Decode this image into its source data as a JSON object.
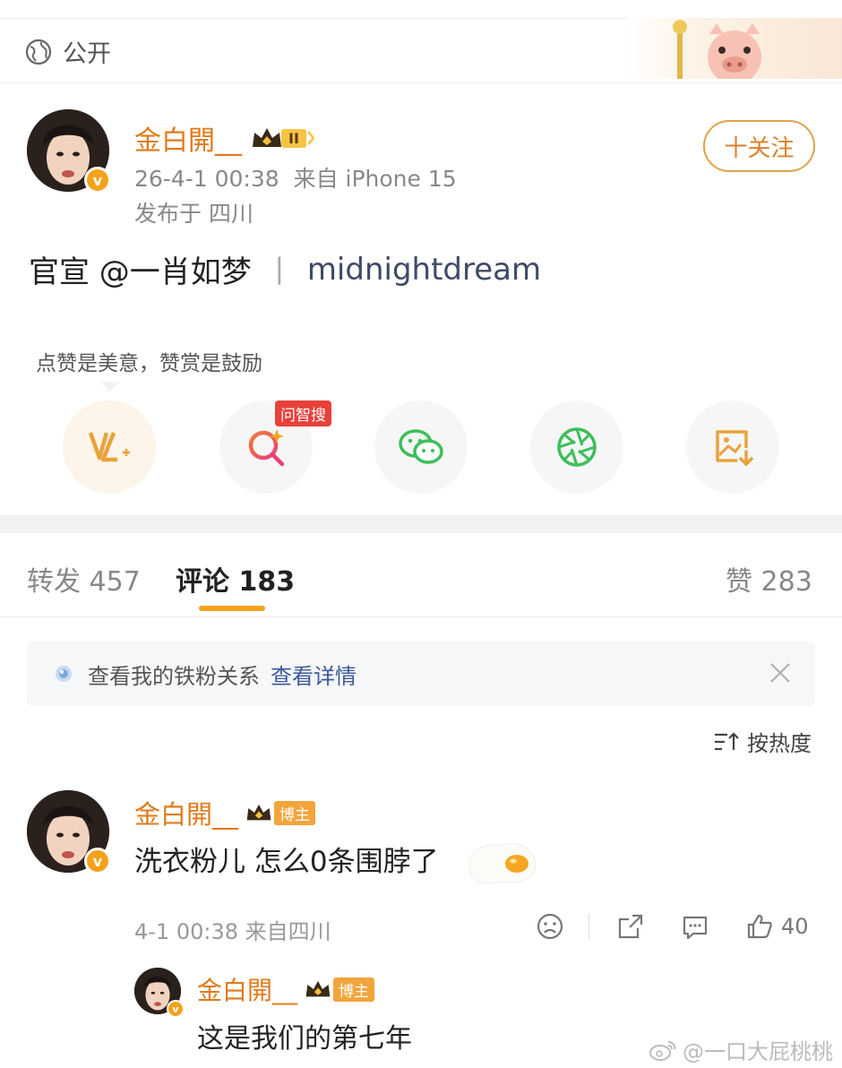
{
  "visibility": {
    "label": "公开"
  },
  "post": {
    "author": "金白開__",
    "level_badge": "II",
    "time": "26-4-1 00:38",
    "source": "来自 iPhone 15",
    "location": "发布于 四川",
    "follow_label": "十关注",
    "mention": "官宣 @一肖如梦",
    "separator": "丨",
    "link_text": "midnightdream"
  },
  "share": {
    "tip": "点赞是美意，赞赏是鼓励",
    "ai_badge": "问智搜",
    "buttons": [
      "support-icon",
      "ai-search-icon",
      "wechat-icon",
      "moments-icon",
      "save-image-icon"
    ]
  },
  "tabs": {
    "repost_label": "转发",
    "repost_count": "457",
    "comment_label": "评论",
    "comment_count": "183",
    "like_label": "赞",
    "like_count": "283"
  },
  "fan_bar": {
    "text": "查看我的铁粉关系",
    "link": "查看详情"
  },
  "sort": {
    "label": "按热度"
  },
  "comment": {
    "author": "金白開__",
    "badge": "博主",
    "text": "洗衣粉儿 怎么0条围脖了",
    "meta": "4-1 00:38 来自四川",
    "like_count": "40"
  },
  "reply": {
    "author": "金白開__",
    "badge": "博主",
    "text": "这是我们的第七年"
  },
  "watermark": {
    "text": "@一口大屁桃桃"
  },
  "colors": {
    "accent": "#f4a21d",
    "name": "#e07a1a",
    "link": "#3e4b67",
    "badge_red": "#e8403a"
  }
}
